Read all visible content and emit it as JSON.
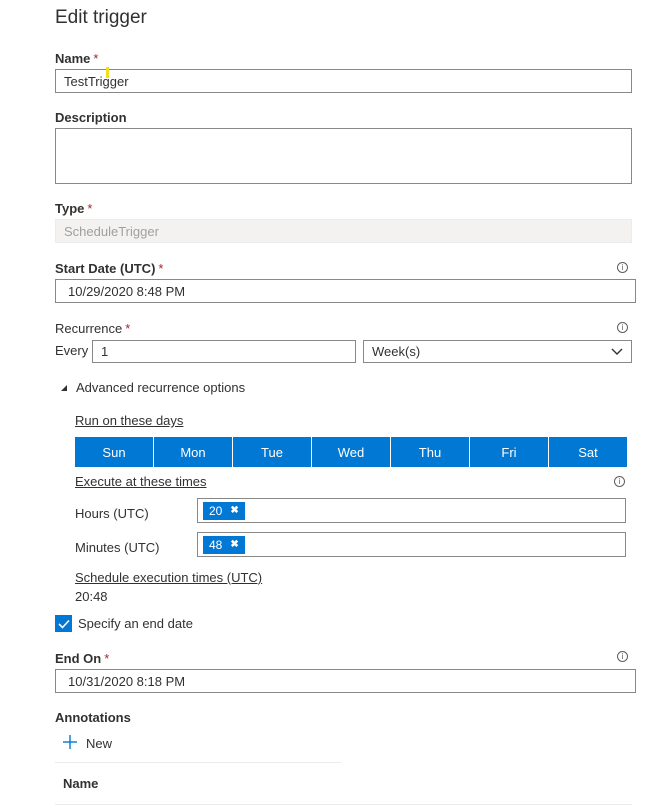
{
  "panel": {
    "title": "Edit trigger"
  },
  "fields": {
    "name": {
      "label": "Name",
      "required": "*",
      "value": "TestTrigger"
    },
    "description": {
      "label": "Description",
      "value": ""
    },
    "type": {
      "label": "Type",
      "required": "*",
      "value": "ScheduleTrigger"
    },
    "start_date": {
      "label": "Start Date (UTC)",
      "required": "*",
      "value": "10/29/2020 8:48 PM"
    },
    "recurrence": {
      "label": "Recurrence",
      "required": "*",
      "every_label": "Every",
      "interval": "1",
      "unit": "Week(s)"
    },
    "end_on": {
      "label": "End On",
      "required": "*",
      "value": "10/31/2020 8:18 PM"
    }
  },
  "advanced": {
    "toggle_label": "Advanced recurrence options",
    "run_days_label": "Run on these days",
    "days": [
      "Sun",
      "Mon",
      "Tue",
      "Wed",
      "Thu",
      "Fri",
      "Sat"
    ],
    "execute_times_label": "Execute at these times",
    "hours_label": "Hours (UTC)",
    "hours_value": "20",
    "minutes_label": "Minutes (UTC)",
    "minutes_value": "48",
    "schedule_label": "Schedule execution times (UTC)",
    "schedule_value": "20:48"
  },
  "end_date_checkbox": {
    "label": "Specify an end date",
    "checked": true
  },
  "annotations": {
    "label": "Annotations",
    "new_label": "New",
    "column_name": "Name"
  },
  "colors": {
    "accent": "#0078d4",
    "required": "#a4262c"
  }
}
